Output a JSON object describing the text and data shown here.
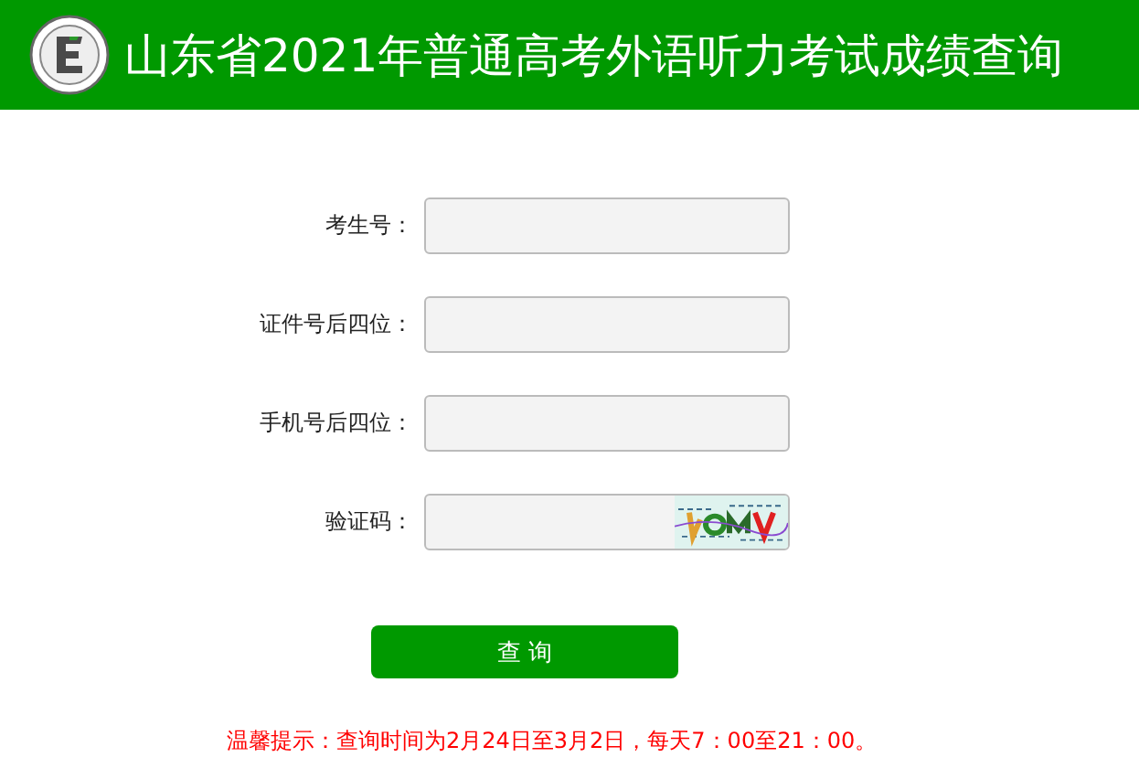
{
  "header": {
    "title": "山东省2021年普通高考外语听力考试成绩查询"
  },
  "form": {
    "fields": [
      {
        "label": "考生号：",
        "kind": "text"
      },
      {
        "label": "证件号后四位：",
        "kind": "text"
      },
      {
        "label": "手机号后四位：",
        "kind": "text"
      },
      {
        "label": "验证码：",
        "kind": "captcha"
      }
    ]
  },
  "submit": {
    "label": "查 询"
  },
  "notice": "温馨提示：查询时间为2月24日至3月2日，每天7：00至21：00。"
}
